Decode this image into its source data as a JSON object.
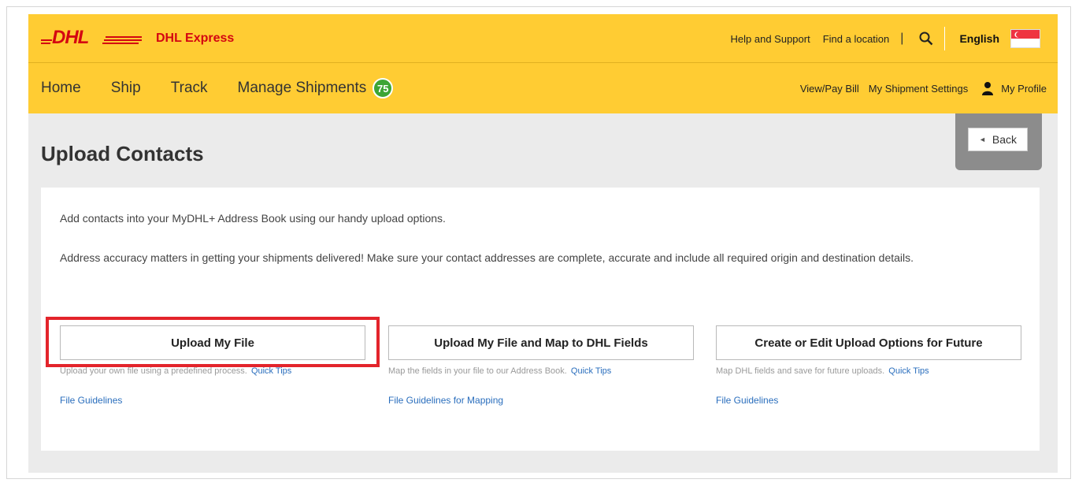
{
  "header": {
    "brand_name": "DHL Express",
    "util_links": [
      "Help and Support",
      "Find a location"
    ],
    "language": "English"
  },
  "nav": {
    "items": [
      "Home",
      "Ship",
      "Track",
      "Manage Shipments"
    ],
    "manage_badge": "75",
    "right_links": [
      "View/Pay Bill",
      "My Shipment Settings",
      "My Profile"
    ]
  },
  "page": {
    "title": "Upload Contacts",
    "back_label": "Back"
  },
  "content": {
    "intro": "Add contacts into your MyDHL+ Address Book using our handy upload options.",
    "intro2": "Address accuracy matters in getting your shipments delivered! Make sure your contact addresses are complete, accurate and include all required origin and destination details.",
    "options": [
      {
        "label": "Upload My File",
        "desc": "Upload your own file using a predefined process.",
        "tip": "Quick Tips",
        "guide": "File Guidelines"
      },
      {
        "label": "Upload My File and Map to DHL Fields",
        "desc": "Map the fields in your file to our Address Book.",
        "tip": "Quick Tips",
        "guide": "File Guidelines for Mapping"
      },
      {
        "label": "Create or Edit Upload Options for Future",
        "desc": "Map DHL fields and save for future uploads.",
        "tip": "Quick Tips",
        "guide": "File Guidelines"
      }
    ]
  },
  "colors": {
    "dhl_yellow": "#ffcc33",
    "dhl_red": "#d40511",
    "link_blue": "#2a6ebd",
    "highlight_red": "#e3242b",
    "badge_green": "#3da535"
  }
}
